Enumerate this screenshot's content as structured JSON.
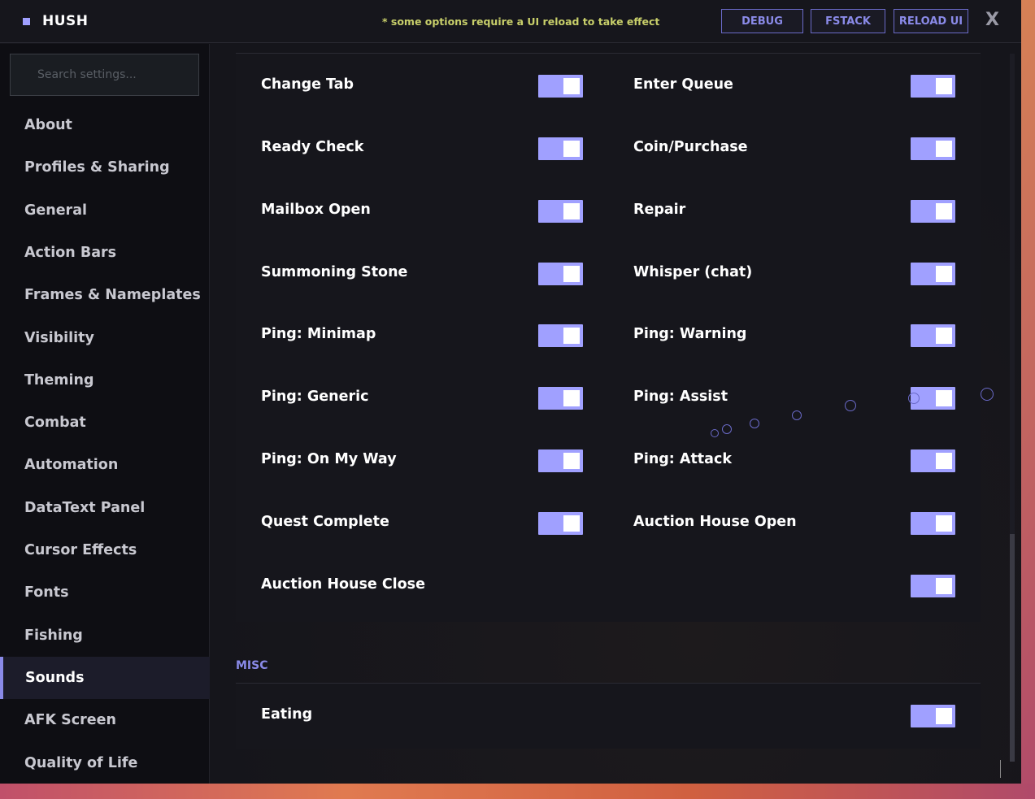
{
  "header": {
    "brand": "HUSH",
    "notice": "* some options require a UI reload to take effect",
    "buttons": {
      "debug": "DEBUG",
      "fstack": "FSTACK",
      "reload": "RELOAD UI"
    },
    "close": "X"
  },
  "sidebar": {
    "search_placeholder": "Search settings...",
    "items": [
      "About",
      "Profiles & Sharing",
      "General",
      "Action Bars",
      "Frames & Nameplates",
      "Visibility",
      "Theming",
      "Combat",
      "Automation",
      "DataText Panel",
      "Cursor Effects",
      "Fonts",
      "Fishing",
      "Sounds",
      "AFK Screen",
      "Quality of Life"
    ],
    "active": "Sounds"
  },
  "sounds": {
    "left": [
      "Change Tab",
      "Ready Check",
      "Mailbox Open",
      "Summoning Stone",
      "Ping: Minimap",
      "Ping: Generic",
      "Ping: On My Way",
      "Quest Complete",
      "Auction House Close"
    ],
    "right": [
      "Enter Queue",
      "Coin/Purchase",
      "Repair",
      "Whisper (chat)",
      "Ping: Warning",
      "Ping: Assist",
      "Ping: Attack",
      "Auction House Open"
    ],
    "toggle_state": "on"
  },
  "misc": {
    "title": "MISC",
    "items": [
      "Eating"
    ]
  },
  "colors": {
    "accent": "#a0a0ff",
    "notice": "#c8cf6a"
  }
}
